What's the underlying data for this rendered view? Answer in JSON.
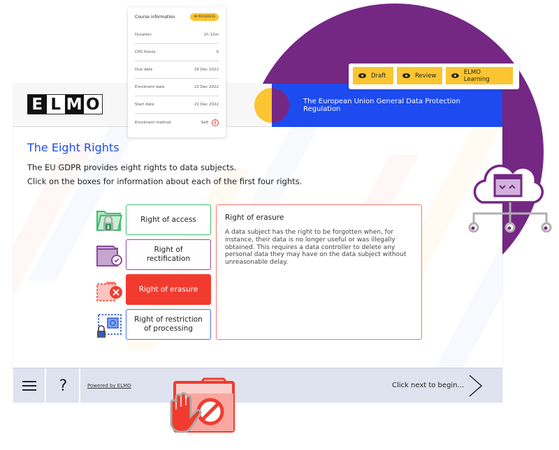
{
  "status_bar": {
    "buttons": [
      {
        "label": "Draft",
        "icon": "eye-icon"
      },
      {
        "label": "Review",
        "icon": "eye-icon"
      },
      {
        "label": "ELMO Learning",
        "icon": "eye-icon"
      }
    ]
  },
  "course_info": {
    "title": "Course information",
    "status_badge": "IN PROGRESS",
    "rows": [
      {
        "label": "Duration",
        "value": "1h 12m"
      },
      {
        "label": "CPD Points",
        "value": "0"
      },
      {
        "label": "Due date",
        "value": "29 Dec 2022"
      },
      {
        "label": "Enrolment date",
        "value": "22 Dec 2022"
      },
      {
        "label": "Start date",
        "value": "22 Dec 2022"
      },
      {
        "label": "Enrolment method",
        "value": "Self",
        "icon": "info-icon"
      }
    ]
  },
  "header": {
    "logo_letters": [
      "E",
      "L",
      "M",
      "O"
    ],
    "course_title": "The European Union General Data Protection Regulation"
  },
  "content": {
    "title": "The Eight Rights",
    "intro_lines": [
      "The EU GDPR provides eight rights to data subjects.",
      "Click on the boxes for information about each of the first four rights."
    ],
    "rights": [
      {
        "label": "Right of access",
        "icon": "folder-lock-icon",
        "color": "#3fbd6e"
      },
      {
        "label": "Right of rectification",
        "icon": "folder-check-icon",
        "color": "#8a4b9b"
      },
      {
        "label": "Right of erasure",
        "icon": "folder-delete-icon",
        "color": "#f23b2f",
        "selected": true
      },
      {
        "label": "Right of restriction of processing",
        "icon": "folder-restrict-icon",
        "color": "#4a72e8"
      }
    ],
    "detail": {
      "title": "Right of erasure",
      "body": "A data subject has the right to be forgotten when, for instance, their data is no longer useful or was illegally obtained. This requires a data controller to delete any personal data they may have on the data subject without unreasonable delay."
    }
  },
  "footer": {
    "menu_icon": "hamburger-menu-icon",
    "help_label": "?",
    "powered_by": "Powered by ELMO",
    "next_prompt": "Click next to begin...",
    "next_icon": "chevron-right-icon"
  },
  "colors": {
    "brand_purple": "#742884",
    "brand_blue": "#1d4bef",
    "brand_yellow": "#fbc531",
    "erasure_red": "#f23b2f",
    "footer_bg": "#dfe2ef"
  }
}
